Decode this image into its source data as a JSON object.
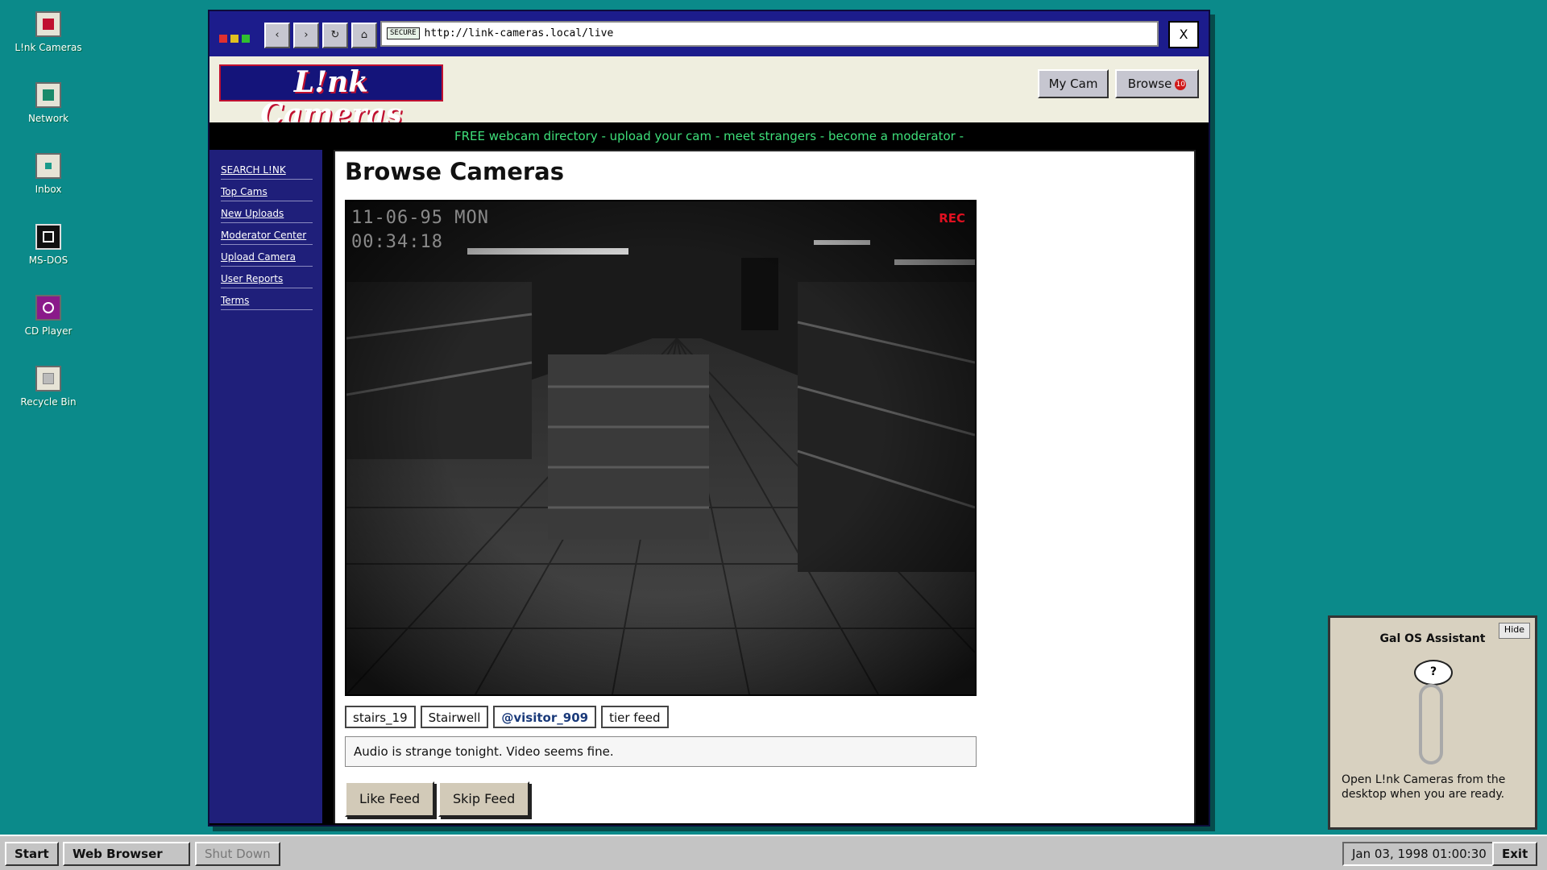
{
  "desktop": {
    "icons": [
      {
        "label": "L!nk Cameras",
        "icon": "link-cameras-icon"
      },
      {
        "label": "Network",
        "icon": "network-icon"
      },
      {
        "label": "Inbox",
        "icon": "inbox-icon"
      },
      {
        "label": "MS-DOS",
        "icon": "ms-dos-icon"
      },
      {
        "label": "CD Player",
        "icon": "cd-player-icon"
      },
      {
        "label": "Recycle Bin",
        "icon": "recycle-bin-icon"
      }
    ]
  },
  "browser": {
    "secure_label": "SECURE",
    "url": "http://link-cameras.local/live",
    "close_label": "X",
    "back_label": "‹",
    "forward_label": "›",
    "reload_label": "↻",
    "home_label": "⌂"
  },
  "site": {
    "logo": "L!nk Cameras",
    "my_cam_label": "My Cam",
    "browse_label": "Browse",
    "browse_count": "10",
    "ticker": "FREE webcam directory - upload your cam - meet strangers - become a moderator -"
  },
  "sidebar": {
    "items": [
      {
        "label": "SEARCH L!NK"
      },
      {
        "label": "Top Cams"
      },
      {
        "label": "New Uploads"
      },
      {
        "label": "Moderator Center"
      },
      {
        "label": "Upload Camera"
      },
      {
        "label": "User Reports"
      },
      {
        "label": "Terms"
      }
    ]
  },
  "main": {
    "title": "Browse Cameras",
    "feed": {
      "date": "11-06-95 MON",
      "time": "00:34:18",
      "rec": "REC"
    },
    "tags": [
      "stairs_19",
      "Stairwell",
      "@visitor_909",
      "tier feed"
    ],
    "comment": "Audio is strange tonight. Video seems fine.",
    "like_label": "Like Feed",
    "skip_label": "Skip Feed"
  },
  "assistant": {
    "hide_label": "Hide",
    "title": "Gal OS Assistant",
    "bubble": "?",
    "message": "Open L!nk Cameras from the desktop when you are ready."
  },
  "taskbar": {
    "start_label": "Start",
    "browser_label": "Web Browser",
    "shutdown_label": "Shut Down",
    "clock": "Jan 03, 1998 01:00:30",
    "exit_label": "Exit"
  },
  "colors": {
    "desktop": "#0b8a8a",
    "titlebar": "#1c1c8c",
    "sidebar": "#1f1f7a",
    "ticker_text": "#3ee07a",
    "rec": "#e01020"
  }
}
